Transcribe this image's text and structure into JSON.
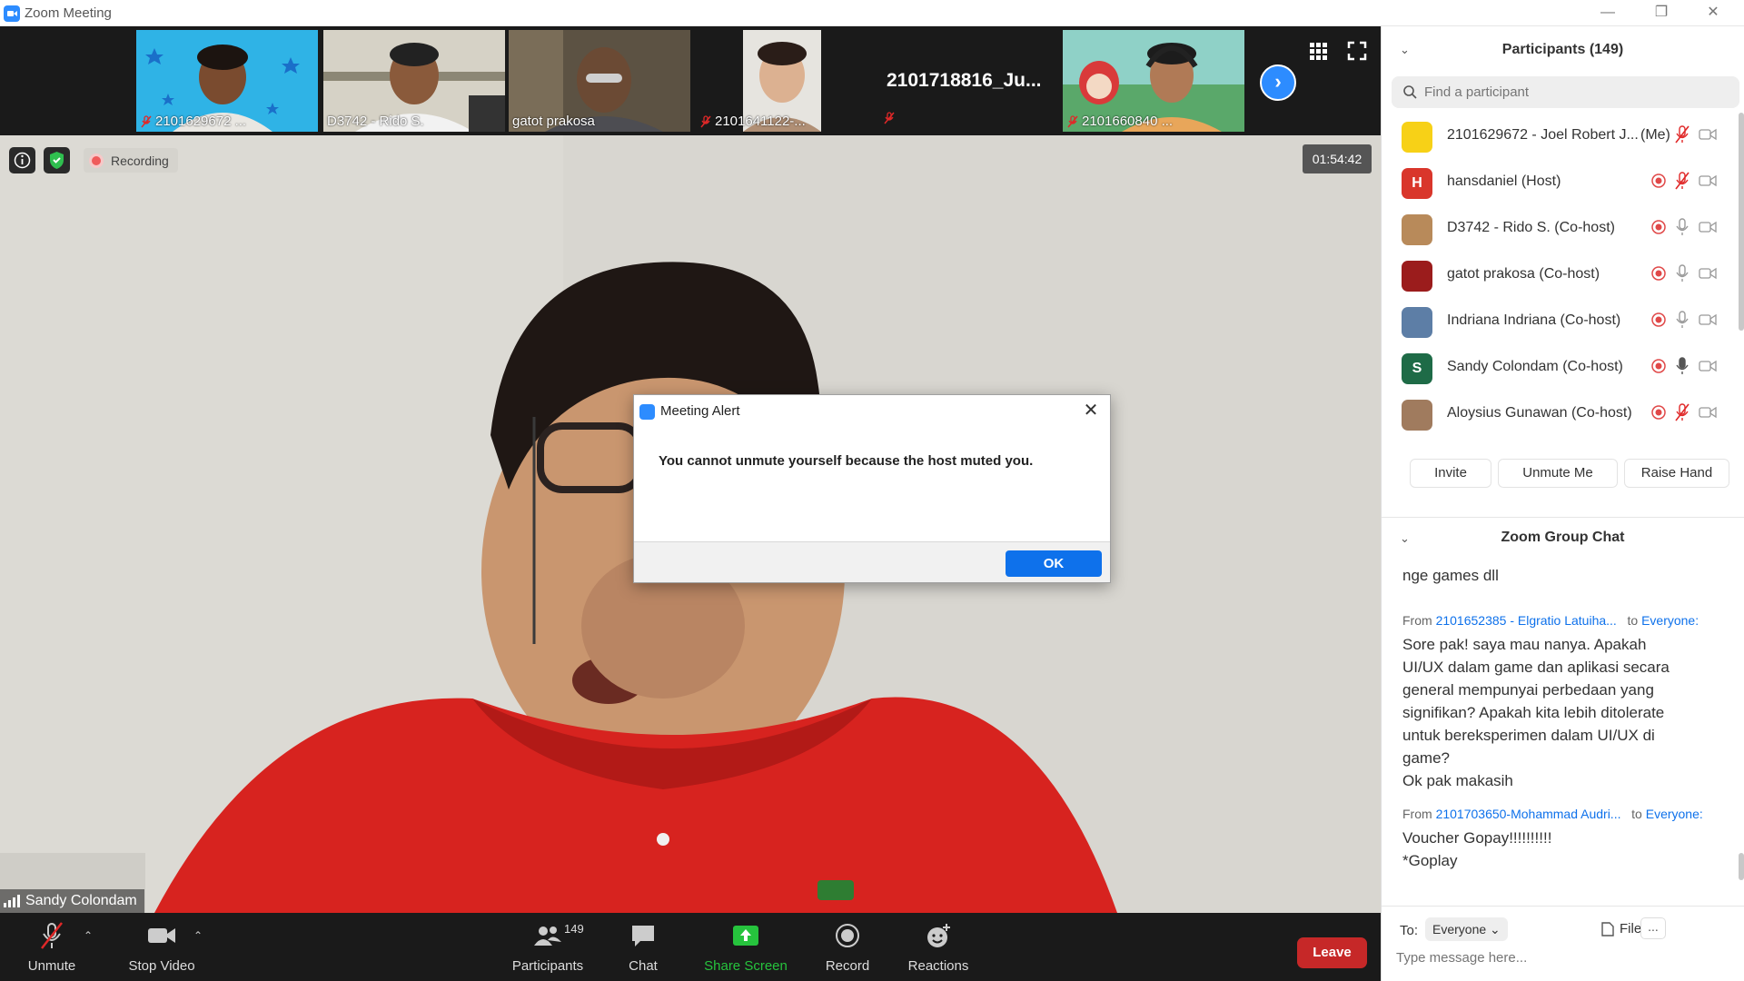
{
  "window": {
    "title": "Zoom Meeting",
    "minimize_icon": "minimize-icon",
    "maximize_icon": "restore-icon",
    "close_icon": "close-icon"
  },
  "strip": {
    "thumbnails": [
      {
        "label": "2101629672 ...",
        "muted": true
      },
      {
        "label": "D3742 - Rido S.",
        "muted": false
      },
      {
        "label": "gatot prakosa",
        "muted": false
      },
      {
        "label": "2101641122-...",
        "muted": true
      },
      {
        "label": "2101718816_Ju...",
        "muted": true,
        "name_only": true
      },
      {
        "label": "2101660840 ...",
        "muted": true
      }
    ],
    "next_icon": "chevron-right-icon",
    "gallery_icon": "grid-icon",
    "fullscreen_icon": "fullscreen-icon"
  },
  "main": {
    "recording_label": "Recording",
    "timer": "01:54:42",
    "speaker_name": "Sandy Colondam"
  },
  "dialog": {
    "title": "Meeting Alert",
    "message": "You cannot unmute yourself because the host muted you.",
    "ok_label": "OK"
  },
  "toolbar": {
    "unmute": "Unmute",
    "stop_video": "Stop Video",
    "participants": "Participants",
    "participants_count": "149",
    "chat": "Chat",
    "share_screen": "Share Screen",
    "record": "Record",
    "reactions": "Reactions",
    "leave": "Leave",
    "accent": "#0e71eb",
    "share_green": "#26c33d",
    "leave_red": "#c62828"
  },
  "participants_panel": {
    "title": "Participants (149)",
    "search_placeholder": "Find a participant",
    "rows": [
      {
        "name": "2101629672 - Joel Robert J...",
        "me": "(Me)",
        "avatar_letter": "",
        "avatar_color": "#f7d117",
        "mic": "muted"
      },
      {
        "name": "hansdaniel (Host)",
        "avatar_letter": "H",
        "avatar_color": "#d9362b",
        "mic": "muted"
      },
      {
        "name": "D3742 - Rido S. (Co-host)",
        "avatar_letter": "",
        "avatar_color": "#b88a5a",
        "mic": "on"
      },
      {
        "name": "gatot prakosa (Co-host)",
        "avatar_letter": "",
        "avatar_color": "#9b1c1c",
        "mic": "on"
      },
      {
        "name": "Indriana Indriana (Co-host)",
        "avatar_letter": "",
        "avatar_color": "#5d7ea6",
        "mic": "on"
      },
      {
        "name": "Sandy Colondam (Co-host)",
        "avatar_letter": "S",
        "avatar_color": "#1e6b47",
        "mic": "on_dark"
      },
      {
        "name": "Aloysius Gunawan (Co-host)",
        "avatar_letter": "",
        "avatar_color": "#a07b5e",
        "mic": "muted"
      }
    ],
    "invite": "Invite",
    "unmute_me": "Unmute Me",
    "raise_hand": "Raise Hand"
  },
  "chat": {
    "title": "Zoom Group Chat",
    "partial_text": "nge games dll",
    "messages": [
      {
        "from_prefix": "From",
        "from": "2101652385 - Elgratio Latuiha...",
        "to_prefix": "to",
        "to": "Everyone:",
        "lines": [
          "Sore pak! saya mau nanya. Apakah",
          "UI/UX dalam game dan aplikasi secara",
          "general mempunyai perbedaan yang",
          "signifikan? Apakah kita lebih ditolerate",
          "untuk bereksperimen dalam UI/UX di",
          "game?",
          "Ok pak makasih"
        ]
      },
      {
        "from_prefix": "From",
        "from": "2101703650-Mohammad Audri...",
        "to_prefix": "to",
        "to": "Everyone:",
        "lines": [
          "Voucher Gopay!!!!!!!!!!",
          "*Goplay"
        ]
      }
    ],
    "to_label": "To:",
    "recipient": "Everyone",
    "file_label": "File",
    "more_label": "...",
    "input_placeholder": "Type message here..."
  }
}
